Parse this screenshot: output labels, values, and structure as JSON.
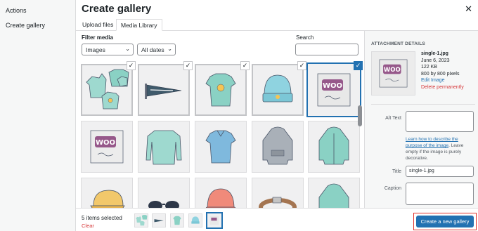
{
  "menu": {
    "heading": "Actions",
    "items": [
      "Create gallery"
    ]
  },
  "modal": {
    "title": "Create gallery"
  },
  "tabs": {
    "upload": "Upload files",
    "library": "Media Library"
  },
  "filters": {
    "label": "Filter media",
    "type_value": "Images",
    "date_value": "All dates",
    "search_label": "Search",
    "search_value": ""
  },
  "grid": {
    "thumbs": [
      "hoodie-bundle",
      "pennant",
      "tshirt",
      "beanie",
      "single-1",
      "single-2",
      "long-sleeve",
      "polo",
      "hoodie",
      "hoodie-zip",
      "cap",
      "sunglasses",
      "beanie-red",
      "belt",
      "hoodie-green"
    ],
    "selected": [
      "hoodie-bundle",
      "pennant",
      "tshirt",
      "beanie",
      "single-1"
    ]
  },
  "details": {
    "heading": "ATTACHMENT DETAILS",
    "filename": "single-1.jpg",
    "date": "June 6, 2023",
    "size": "122 KB",
    "dimensions": "800 by 800 pixels",
    "edit_link": "Edit Image",
    "delete_link": "Delete permanently",
    "alt_label": "Alt Text",
    "alt_help_link": "Learn how to describe the purpose of the image",
    "alt_help_text": ". Leave empty if the image is purely decorative.",
    "title_label": "Title",
    "title_value": "single-1.jpg",
    "caption_label": "Caption"
  },
  "footer": {
    "selected_count": "5 items selected",
    "clear": "Clear",
    "button": "Create a new gallery"
  },
  "colors": {
    "accent": "#2271b1",
    "danger": "#d63638",
    "highlight": "#e0322b"
  }
}
